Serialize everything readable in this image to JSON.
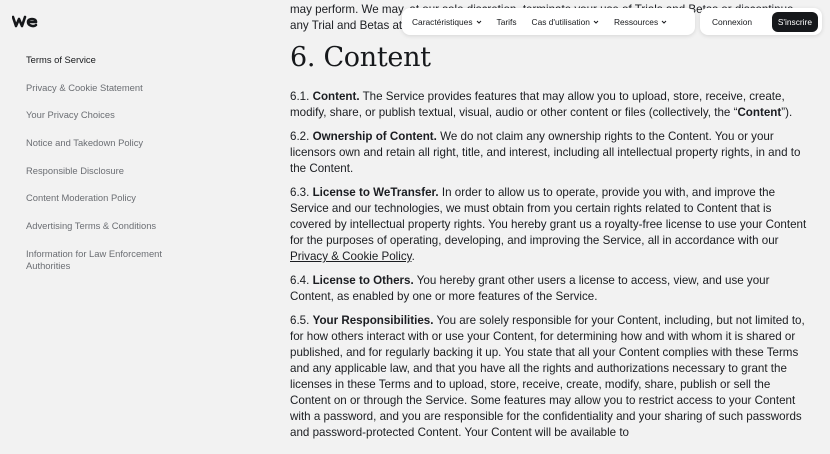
{
  "brand": {
    "logo_icon": "wetransfer-logo-icon"
  },
  "sidebar": {
    "items": [
      {
        "label": "Terms of Service",
        "active": true
      },
      {
        "label": "Privacy & Cookie Statement",
        "active": false
      },
      {
        "label": "Your Privacy Choices",
        "active": false
      },
      {
        "label": "Notice and Takedown Policy",
        "active": false
      },
      {
        "label": "Responsible Disclosure",
        "active": false
      },
      {
        "label": "Content Moderation Policy",
        "active": false
      },
      {
        "label": "Advertising Terms & Conditions",
        "active": false
      },
      {
        "label": "Information for Law Enforcement Authorities",
        "active": false
      }
    ]
  },
  "nav": {
    "items": [
      {
        "label": "Caractéristiques",
        "has_dropdown": true
      },
      {
        "label": "Tarifs",
        "has_dropdown": false
      },
      {
        "label": "Cas d'utilisation",
        "has_dropdown": true
      },
      {
        "label": "Ressources",
        "has_dropdown": true
      }
    ],
    "login": "Connexion",
    "signup": "S'inscrire"
  },
  "main": {
    "top_text": "may perform. We may, at our sole discretion, terminate your use of Trials and Betas or discontinue any Trial and Betas at any time.",
    "heading": "6. Content",
    "p1_num": "6.1.",
    "p1_head": "Content.",
    "p1_text": " The Service provides features that may allow you to upload, store, receive, create, modify, share, or publish textual, visual, audio or other content or files (collectively, the “",
    "p1_bold": "Content",
    "p1_end": "”).",
    "p2_num": "6.2.",
    "p2_head": "Ownership of Content.",
    "p2_text": " We do not claim any ownership rights to the Content. You or your licensors own and retain all right, title, and interest, including all intellectual property rights, in and to the Content.",
    "p3_num": "6.3.",
    "p3_head": "License to WeTransfer.",
    "p3_text": " In order to allow us to operate, provide you with, and improve the Service and our technologies, we must obtain from you certain rights related to Content that is covered by intellectual property rights. You hereby grant us a royalty-free license to use your Content for the purposes of operating, developing, and improving the Service, all in accordance with our ",
    "p3_link": "Privacy & Cookie Policy",
    "p3_end": ".",
    "p4_num": "6.4.",
    "p4_head": "License to Others.",
    "p4_text": " You hereby grant other users a license to access, view, and use your Content, as enabled by one or more features of the Service.",
    "p5_num": "6.5.",
    "p5_head": "Your Responsibilities.",
    "p5_text": " You are solely responsible for your Content, including, but not limited to, for how others interact with or use your Content, for determining how and with whom it is shared or published, and for regularly backing it up. You state that all your Content complies with these Terms and any applicable law, and that you have all the rights and authorizations necessary to grant the licenses in these Terms and to upload, store, receive, create, modify, share, publish or sell the Content on or through the Service. Some features may allow you to restrict access to your Content with a password, and you are responsible for the confidentiality and your sharing of such passwords and password-protected Content. Your Content will be available to"
  }
}
